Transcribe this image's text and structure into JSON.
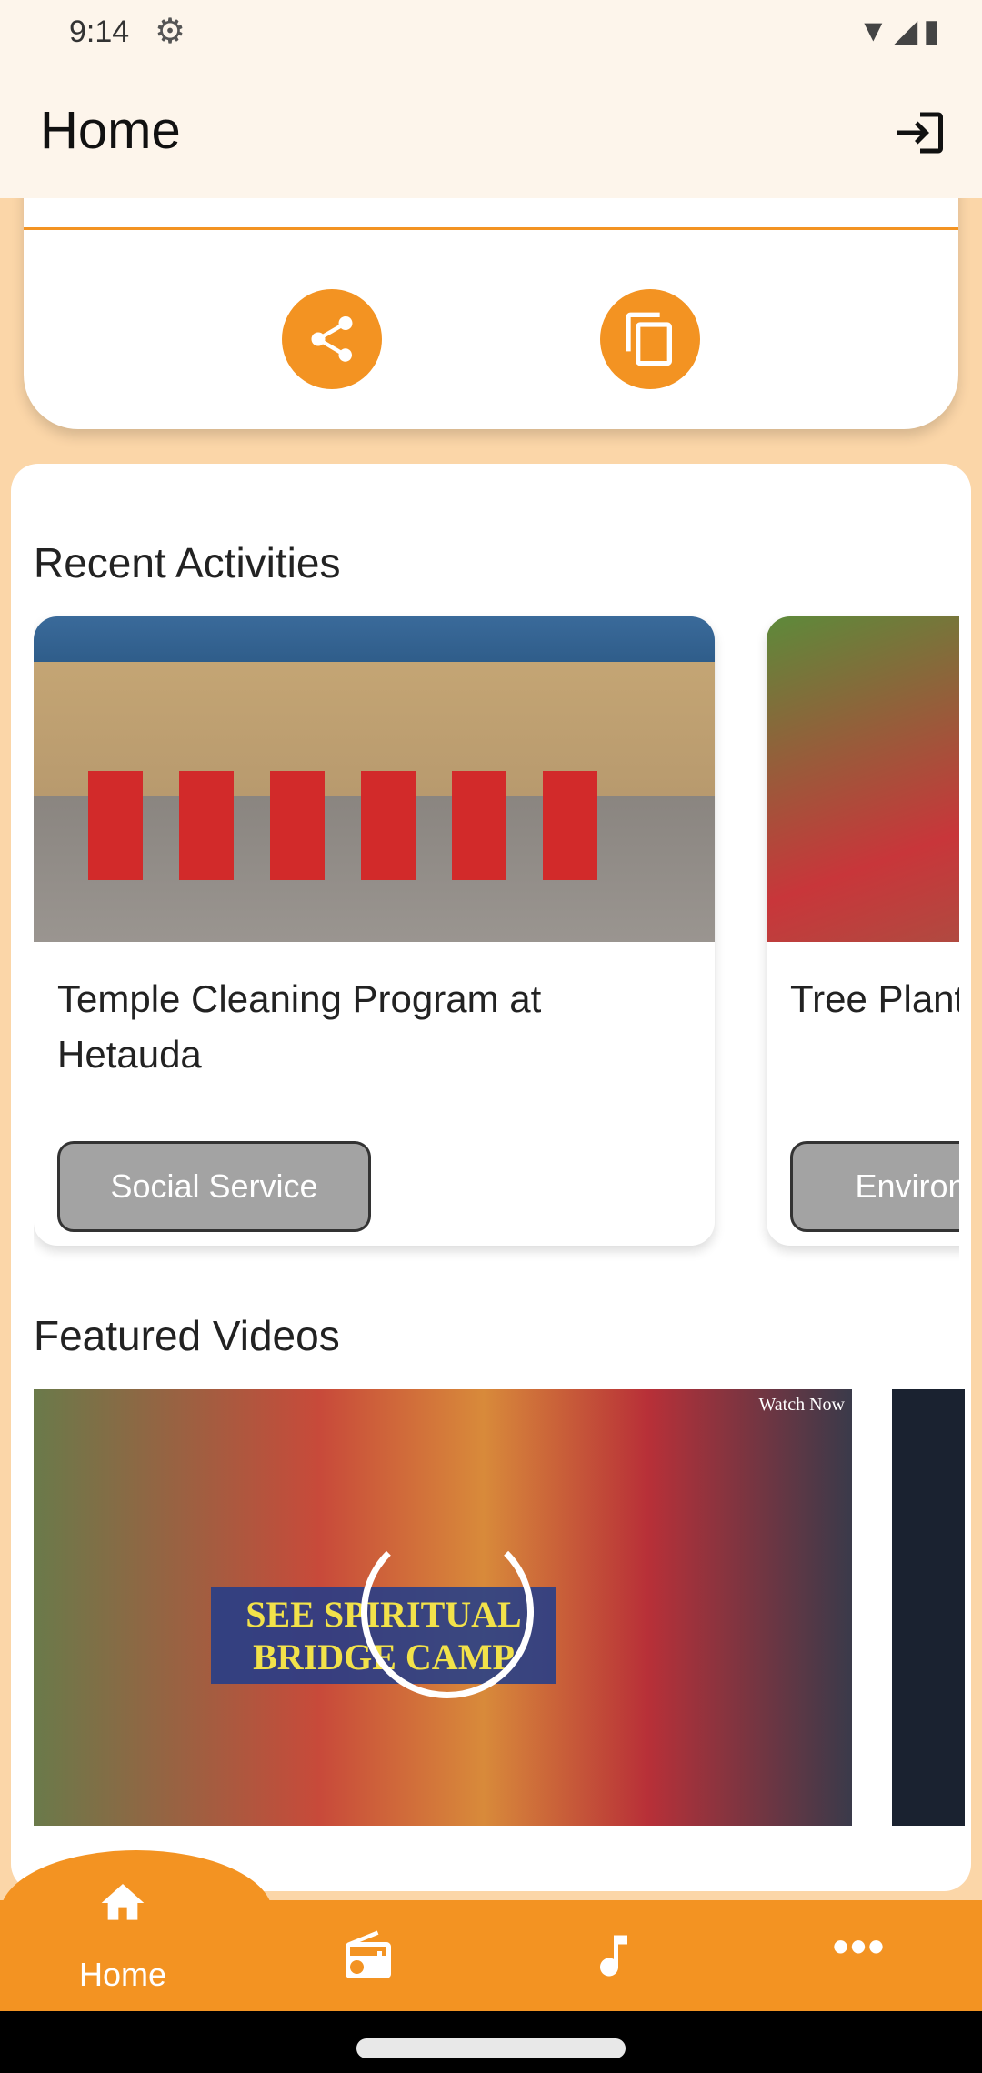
{
  "status_bar": {
    "time": "9:14"
  },
  "app_bar": {
    "title": "Home"
  },
  "recent": {
    "title": "Recent Activities",
    "items": [
      {
        "title": "Temple Cleaning Program at Hetauda",
        "category": "Social Service"
      },
      {
        "title": "Tree Plantation at Jagadguru...",
        "category": "Environment"
      }
    ]
  },
  "videos": {
    "title": "Featured Videos",
    "items": [
      {
        "overlay_text": "SEE SPIRITUAL BRIDGE CAMP",
        "badge": "Watch Now"
      }
    ]
  },
  "bottom_nav": {
    "items": [
      {
        "label": "Home",
        "icon": "home-icon",
        "active": true
      },
      {
        "label": "",
        "icon": "radio-icon"
      },
      {
        "label": "",
        "icon": "music-note-icon"
      },
      {
        "label": "",
        "icon": "more-icon"
      }
    ]
  },
  "colors": {
    "accent": "#f39322",
    "background": "#fbd6a8",
    "appbar": "#fdf5eb"
  }
}
